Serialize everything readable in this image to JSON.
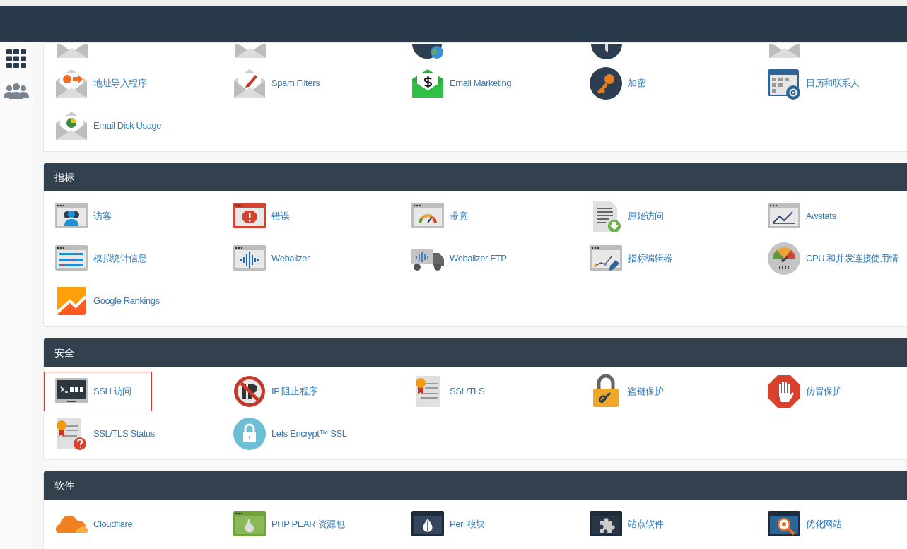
{
  "sections": [
    {
      "items": [
        {
          "selected": false
        },
        {
          "selected": false
        },
        {
          "selected": false
        },
        {
          "selected": false
        },
        {
          "selected": false
        },
        {
          "label": "地址导入程序",
          "selected": false
        },
        {
          "label": "Spam Filters",
          "selected": false
        },
        {
          "label": "Email Marketing",
          "selected": false
        },
        {
          "label": "加密",
          "selected": false
        },
        {
          "label": "日历和联系人",
          "selected": false
        },
        {
          "label": "Email Disk Usage",
          "selected": false
        }
      ]
    },
    {
      "title": "指标",
      "items": [
        {
          "label": "访客",
          "selected": false
        },
        {
          "label": "错误",
          "selected": false
        },
        {
          "label": "带宽",
          "selected": false
        },
        {
          "label": "原始访问",
          "selected": false
        },
        {
          "label": "Awstats",
          "selected": false
        },
        {
          "label": "模拟统计信息",
          "selected": false
        },
        {
          "label": "Webalizer",
          "selected": false
        },
        {
          "label": "Webalizer FTP",
          "selected": false
        },
        {
          "label": "指标编辑器",
          "selected": false
        },
        {
          "label": "CPU 和并发连接使用情",
          "selected": false
        },
        {
          "label": "Google Rankings",
          "selected": false
        }
      ]
    },
    {
      "title": "安全",
      "items": [
        {
          "label": "SSH 访问",
          "selected": true
        },
        {
          "label": "IP 阻止程序",
          "selected": false
        },
        {
          "label": "SSL/TLS",
          "selected": false
        },
        {
          "label": "盗链保护",
          "selected": false
        },
        {
          "label": "仿冒保护",
          "selected": false
        },
        {
          "label": "SSL/TLS Status",
          "selected": false
        },
        {
          "label": "Lets Encrypt™ SSL",
          "selected": false
        }
      ]
    },
    {
      "title": "软件",
      "items": [
        {
          "label": "Cloudflare",
          "selected": false
        },
        {
          "label": "PHP PEAR 资源包",
          "selected": false
        },
        {
          "label": "Perl 模块",
          "selected": false
        },
        {
          "label": "站点软件",
          "selected": false
        },
        {
          "label": "优化网站",
          "selected": false
        }
      ]
    }
  ]
}
